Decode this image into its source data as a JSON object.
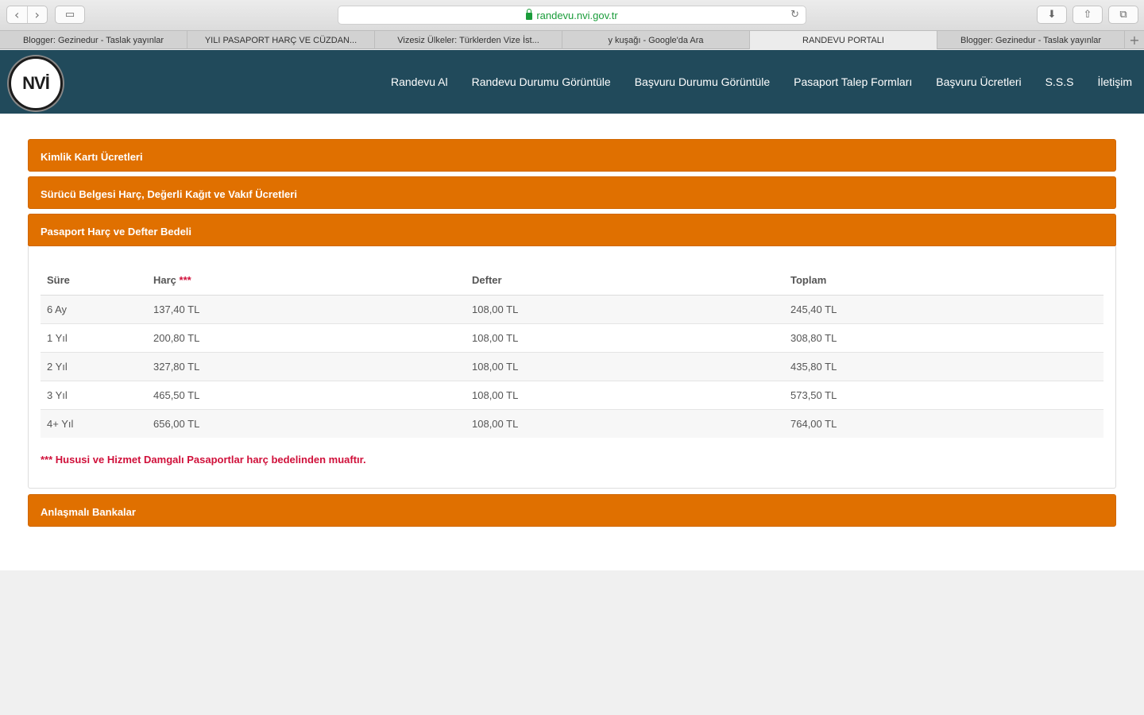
{
  "browser": {
    "url": "randevu.nvi.gov.tr",
    "tabs": [
      {
        "label": "Blogger: Gezinedur - Taslak yayınlar",
        "active": false
      },
      {
        "label": "YILI PASAPORT HARÇ VE CÜZDAN...",
        "active": false
      },
      {
        "label": "Vizesiz Ülkeler: Türklerden Vize İst...",
        "active": false
      },
      {
        "label": "y kuşağı - Google'da Ara",
        "active": false
      },
      {
        "label": "RANDEVU PORTALI",
        "active": true
      },
      {
        "label": "Blogger: Gezinedur - Taslak yayınlar",
        "active": false
      }
    ]
  },
  "header": {
    "logo_text": "NVİ",
    "nav": [
      "Randevu Al",
      "Randevu Durumu Görüntüle",
      "Başvuru Durumu Görüntüle",
      "Pasaport Talep Formları",
      "Başvuru Ücretleri",
      "S.S.S",
      "İletişim"
    ]
  },
  "panels": {
    "kimlik": "Kimlik Kartı Ücretleri",
    "surucu": "Sürücü Belgesi Harç, Değerli Kağıt ve Vakıf Ücretleri",
    "pasaport": "Pasaport Harç ve Defter Bedeli",
    "bankalar": "Anlaşmalı Bankalar"
  },
  "passport_table": {
    "headers": {
      "sure": "Süre",
      "harc": "Harç",
      "harc_mark": "***",
      "defter": "Defter",
      "toplam": "Toplam"
    },
    "rows": [
      [
        "6 Ay",
        "137,40 TL",
        "108,00 TL",
        "245,40 TL"
      ],
      [
        "1 Yıl",
        "200,80 TL",
        "108,00 TL",
        "308,80 TL"
      ],
      [
        "2 Yıl",
        "327,80 TL",
        "108,00 TL",
        "435,80 TL"
      ],
      [
        "3 Yıl",
        "465,50 TL",
        "108,00 TL",
        "573,50 TL"
      ],
      [
        "4+ Yıl",
        "656,00 TL",
        "108,00 TL",
        "764,00 TL"
      ]
    ],
    "note": "*** Hususi ve Hizmet Damgalı Pasaportlar harç bedelinden muaftır."
  },
  "colors": {
    "header_bg": "#214a5b",
    "accent": "#e07000",
    "note": "#d0103a"
  }
}
